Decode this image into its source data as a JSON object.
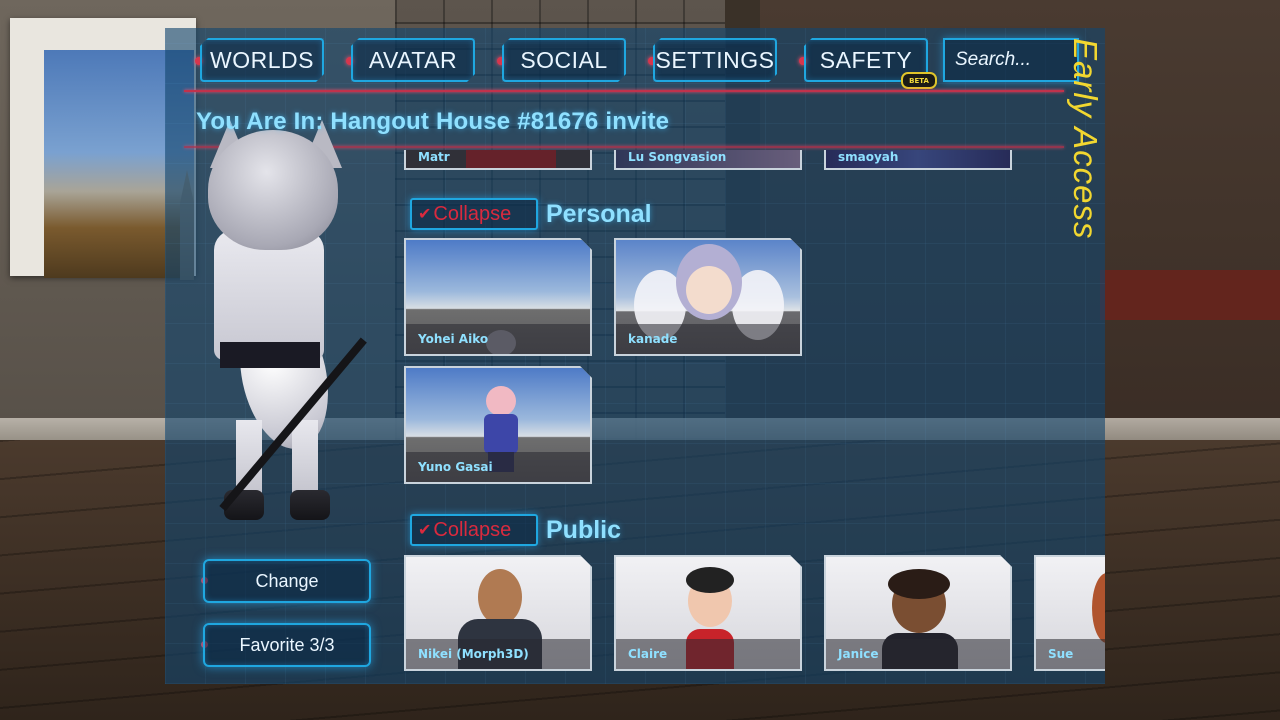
{
  "nav": {
    "tabs": [
      {
        "label": "WORLDS"
      },
      {
        "label": "AVATAR"
      },
      {
        "label": "SOCIAL"
      },
      {
        "label": "SETTINGS"
      },
      {
        "label": "SAFETY"
      }
    ],
    "beta_badge": "BETA",
    "search_placeholder": "Search..."
  },
  "early_access": "Early Access",
  "status": "You Are In: Hangout House #81676 invite",
  "sidebar": {
    "change_label": "Change",
    "favorite_label": "Favorite 3/3"
  },
  "top_row": [
    {
      "name": "Matr"
    },
    {
      "name": "Lu Songvasion"
    },
    {
      "name": "smaoyah"
    }
  ],
  "sections": {
    "personal": {
      "collapse_label": "Collapse",
      "title": "Personal",
      "avatars": [
        {
          "name": "Yohei Aiko"
        },
        {
          "name": "kanade"
        },
        {
          "name": "Yuno Gasai"
        }
      ]
    },
    "public": {
      "collapse_label": "Collapse",
      "title": "Public",
      "avatars": [
        {
          "name": "Nikei (Morph3D)"
        },
        {
          "name": "Claire"
        },
        {
          "name": "Janice"
        },
        {
          "name": "Sue"
        }
      ]
    }
  },
  "colors": {
    "accent": "#1fa7e0",
    "text_cyan": "#8fe0ff",
    "collapse_red": "#d92a3e",
    "early_access_yellow": "#f2d730"
  }
}
